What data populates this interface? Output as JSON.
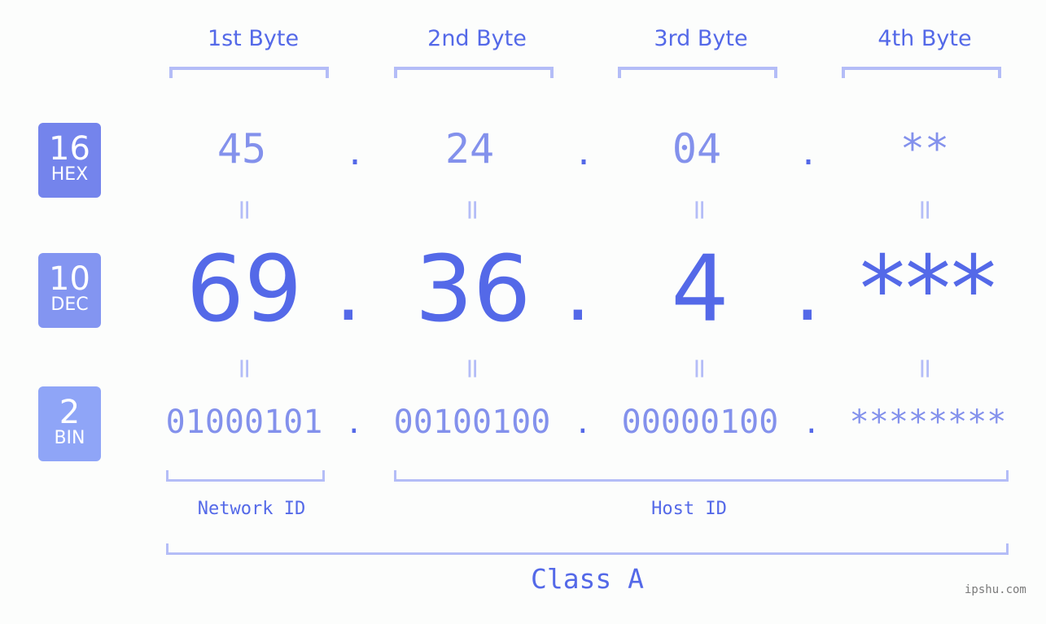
{
  "bytes": {
    "labels": [
      "1st Byte",
      "2nd Byte",
      "3rd Byte",
      "4th Byte"
    ]
  },
  "badges": {
    "hex": {
      "base": "16",
      "name": "HEX"
    },
    "dec": {
      "base": "10",
      "name": "DEC"
    },
    "bin": {
      "base": "2",
      "name": "BIN"
    }
  },
  "separator": ".",
  "equals": "=",
  "hex": [
    "45",
    "24",
    "04",
    "**"
  ],
  "dec": [
    "69",
    "36",
    "4",
    "***"
  ],
  "bin": [
    "01000101",
    "00100100",
    "00000100",
    "********"
  ],
  "sections": {
    "network": "Network ID",
    "host": "Host ID",
    "class": "Class A"
  },
  "watermark": "ipshu.com",
  "colors": {
    "accent": "#5469e8",
    "light_value": "#8391ec",
    "bracket": "#b4bdf7",
    "hex_badge": "#7484ec",
    "dec_badge": "#8395f1",
    "bin_badge": "#8fa5f7"
  }
}
